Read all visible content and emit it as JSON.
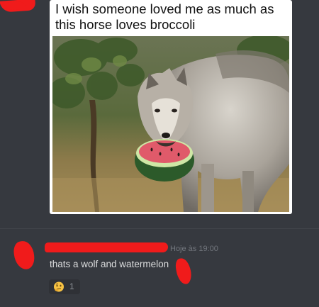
{
  "meme": {
    "caption": "I wish someone loved me as much as this horse loves broccoli",
    "image_description": "wolf holding a watermelon slice in its mouth"
  },
  "message": {
    "timestamp": "Hoje às 19:00",
    "text": "thats a wolf and watermelon"
  },
  "reaction": {
    "emoji": "thinking-face-emoji",
    "count": "1"
  },
  "colors": {
    "background": "#36393f",
    "redaction": "#f01b1b",
    "message_text": "#dcddde",
    "timestamp": "#72767d",
    "reaction_bg": "#2f3136"
  }
}
